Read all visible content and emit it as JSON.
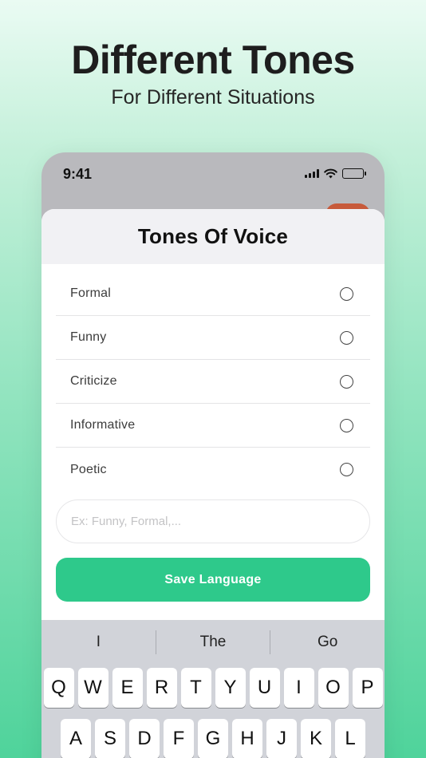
{
  "headline": "Different Tones",
  "subheadline": "For Different Situations",
  "status_bar": {
    "time": "9:41",
    "icons": [
      "cellular-signal-icon",
      "wifi-icon",
      "battery-icon"
    ]
  },
  "sheet": {
    "title": "Tones Of Voice",
    "options": [
      {
        "label": "Formal",
        "selected": false
      },
      {
        "label": "Funny",
        "selected": false
      },
      {
        "label": "Criticize",
        "selected": false
      },
      {
        "label": "Informative",
        "selected": false
      },
      {
        "label": "Poetic",
        "selected": false
      }
    ],
    "custom_input": {
      "value": "",
      "placeholder": "Ex: Funny, Formal,..."
    },
    "save_label": "Save Language"
  },
  "keyboard": {
    "suggestions": [
      "I",
      "The",
      "Go"
    ],
    "row1": [
      "Q",
      "W",
      "E",
      "R",
      "T",
      "Y",
      "U",
      "I",
      "O",
      "P"
    ],
    "row2": [
      "A",
      "S",
      "D",
      "F",
      "G",
      "H",
      "J",
      "K",
      "L"
    ]
  },
  "colors": {
    "accent": "#2ec98b",
    "sheet_header": "#f1f1f4",
    "background_top": "#eafbf3",
    "background_bottom": "#4fd39b",
    "orange_button": "#c75a3b"
  }
}
